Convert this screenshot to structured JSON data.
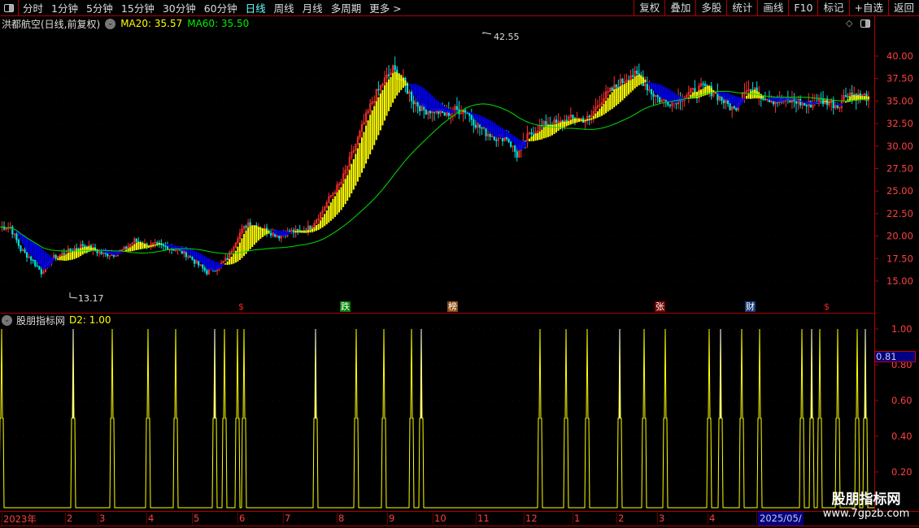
{
  "toolbar": {
    "periods": [
      "分时",
      "1分钟",
      "5分钟",
      "15分钟",
      "30分钟",
      "60分钟",
      "日线",
      "周线",
      "月线",
      "多周期",
      "更多 >"
    ],
    "active": "日线",
    "right_buttons": [
      "复权",
      "叠加",
      "多股",
      "统计",
      "画线",
      "F10",
      "标记",
      "+自选",
      "返回"
    ]
  },
  "title": {
    "stock": "洪都航空(日线,前复权)",
    "ma20": "MA20: 35.57",
    "ma60": "MA60: 35.50"
  },
  "indicator": {
    "name": "股朋指标网",
    "value": "D2: 1.00",
    "cursor_value": "0.81"
  },
  "markers": [
    {
      "text": "$",
      "color": "#ff2020",
      "bg": "transparent"
    },
    {
      "text": "跌",
      "color": "#fff",
      "bg": "#008000"
    },
    {
      "text": "榜",
      "color": "#fff",
      "bg": "#8b4a10"
    },
    {
      "text": "张",
      "color": "#fff",
      "bg": "#7a0000"
    },
    {
      "text": "财",
      "color": "#fff",
      "bg": "#1a3a7a"
    },
    {
      "text": "$",
      "color": "#ff2020",
      "bg": "transparent"
    }
  ],
  "dates": [
    "2023年",
    "2",
    "3",
    "4",
    "5",
    "6",
    "7",
    "8",
    "9",
    "10",
    "11",
    "12",
    "1",
    "2",
    "3",
    "4",
    "5"
  ],
  "current_date": "2025/05/",
  "watermark": {
    "line1": "股朋指标网",
    "line2": "www.7gpzb.com"
  },
  "colors": {
    "up": "#ff3030",
    "down": "#00e0e0",
    "ma20": "#ffff00",
    "ma60": "#00e000",
    "ribbon_down": "#0000ff",
    "indicator": "#ffff00",
    "axis": "#ff4040"
  },
  "chart_data": [
    {
      "type": "candlestick",
      "title": "洪都航空(日线,前复权)",
      "ylim": [
        13,
        43
      ],
      "yticks": [
        "40.00",
        "37.50",
        "35.00",
        "32.50",
        "30.00",
        "27.50",
        "25.00",
        "22.50",
        "20.00",
        "17.50",
        "15.00"
      ],
      "annotations": [
        {
          "text": "42.55",
          "label": "high"
        },
        {
          "text": "13.17",
          "label": "low"
        }
      ],
      "close": [
        21,
        21,
        18.5,
        17.5,
        16,
        17.5,
        18,
        18.5,
        19,
        18.5,
        18,
        18,
        18.5,
        19.5,
        19,
        19,
        18.8,
        18.5,
        18,
        17,
        16,
        16.5,
        17.5,
        20,
        21.5,
        21,
        20.5,
        20,
        20.5,
        20.5,
        21,
        22.5,
        24.5,
        26,
        29,
        32,
        35,
        37,
        38.5,
        37,
        35,
        34,
        34,
        33.5,
        34,
        34,
        32.5,
        31.5,
        31,
        31,
        29,
        31,
        32,
        32.5,
        32.5,
        33,
        33,
        33,
        35,
        36,
        37,
        38,
        37.5,
        36,
        35,
        35,
        35.5,
        36,
        36.5,
        36,
        35,
        34,
        36.5,
        36,
        35.5,
        35,
        35,
        35,
        34.5,
        35,
        35,
        34.5,
        36,
        35.5,
        35.5
      ]
    },
    {
      "type": "step-pulse",
      "name": "股朋指标网 D2",
      "ylim": [
        0,
        1.05
      ],
      "yticks": [
        "1.00",
        "0.80",
        "0.60",
        "0.40",
        "0.20"
      ],
      "pulse_values": 1.0,
      "pulse_mid": 0.5
    }
  ]
}
